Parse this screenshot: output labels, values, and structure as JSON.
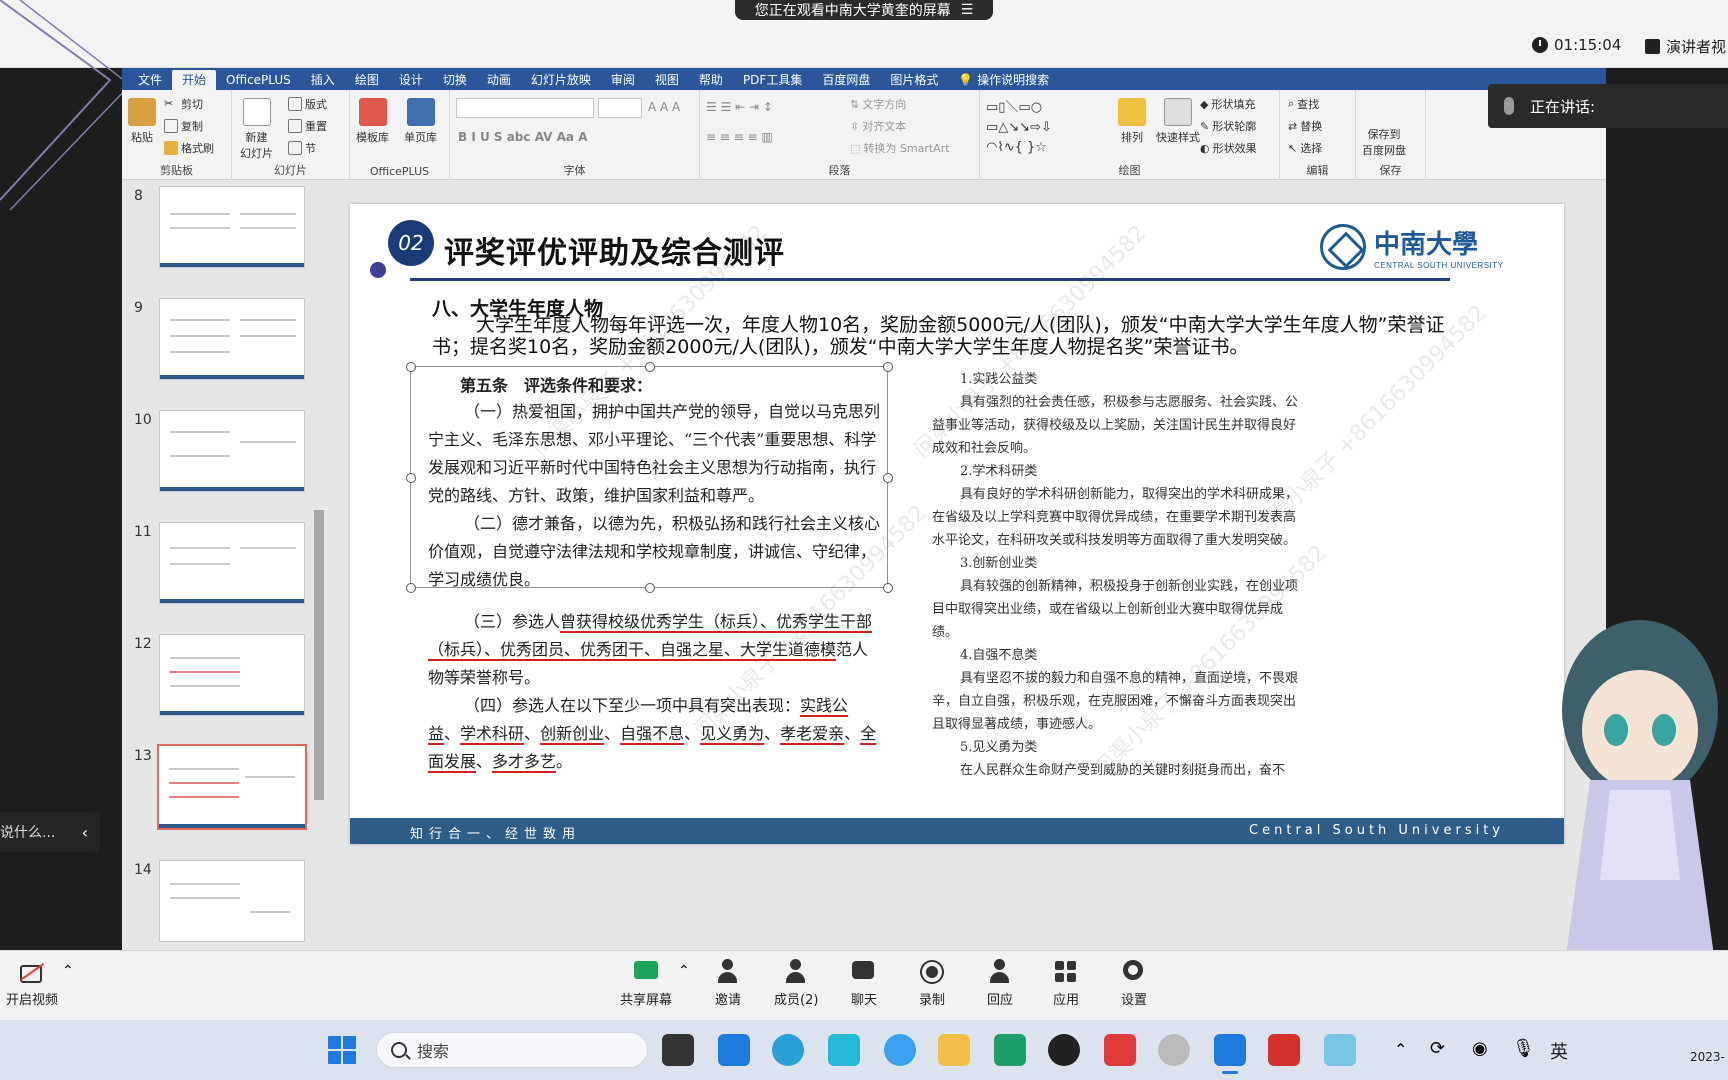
{
  "meeting": {
    "share_banner": "您正在观看中南大学黄奎的屏幕",
    "timer": "01:15:04",
    "speaker_view": "演讲者视",
    "caption_status": "正在讲话:",
    "left_hint": "说什么...",
    "toolbar": [
      {
        "label": "开启视频",
        "icon": "camera-off-icon"
      },
      {
        "label": "共享屏幕",
        "icon": "share-screen-icon"
      },
      {
        "label": "邀请",
        "icon": "invite-icon"
      },
      {
        "label": "成员(2)",
        "icon": "members-icon"
      },
      {
        "label": "聊天",
        "icon": "chat-icon"
      },
      {
        "label": "录制",
        "icon": "record-icon"
      },
      {
        "label": "回应",
        "icon": "reaction-icon"
      },
      {
        "label": "应用",
        "icon": "apps-icon"
      },
      {
        "label": "设置",
        "icon": "settings-icon"
      }
    ]
  },
  "ppt": {
    "menu_tabs": [
      "文件",
      "开始",
      "OfficePLUS",
      "插入",
      "绘图",
      "设计",
      "切换",
      "动画",
      "幻灯片放映",
      "审阅",
      "视图",
      "帮助",
      "PDF工具集",
      "百度网盘",
      "图片格式",
      "操作说明搜索"
    ],
    "active_tab": "开始",
    "ribbon": {
      "clipboard": {
        "label": "剪贴板",
        "paste": "粘贴",
        "cut": "剪切",
        "copy": "复制",
        "format_painter": "格式刷"
      },
      "slides": {
        "label": "幻灯片",
        "new_slide": "新建\n幻灯片",
        "layout": "版式",
        "reset": "重置",
        "section": "节"
      },
      "officeplus": {
        "label": "OfficePLUS",
        "template": "模板库",
        "single": "单页库"
      },
      "font": {
        "label": "字体"
      },
      "paragraph": {
        "label": "段落",
        "text_direction": "文字方向",
        "align_text": "对齐文本",
        "smartart": "转换为 SmartArt"
      },
      "drawing": {
        "label": "绘图",
        "arrange": "排列",
        "quick_styles": "快速样式",
        "fill": "形状填充",
        "outline": "形状轮廓",
        "effects": "形状效果"
      },
      "editing": {
        "label": "编辑",
        "find": "查找",
        "replace": "替换",
        "select": "选择"
      },
      "save": {
        "label": "保存",
        "save_baidu": "保存到\n百度网盘"
      }
    },
    "thumbnails": [
      {
        "num": "8"
      },
      {
        "num": "9"
      },
      {
        "num": "10"
      },
      {
        "num": "11"
      },
      {
        "num": "12"
      },
      {
        "num": "13",
        "selected": true
      },
      {
        "num": "14"
      }
    ],
    "slide": {
      "badge": "02",
      "title": "评奖评优评助及综合测评",
      "logo_cn": "中南大學",
      "logo_en": "CENTRAL SOUTH UNIVERSITY",
      "section_heading": "八、大学生年度人物",
      "section_intro": "大学生年度人物每年评选一次，年度人物10名，奖励金额5000元/人(团队)，颁发“中南大学大学生年度人物”荣誉证书；提名奖10名，奖励金额2000元/人(团队)，颁发“中南大学大学生年度人物提名奖”荣誉证书。",
      "article_heading": "第五条　评选条件和要求：",
      "article_p1": "（一）热爱祖国，拥护中国共产党的领导，自觉以马克思列宁主义、毛泽东思想、邓小平理论、“三个代表”重要思想、科学发展观和习近平新时代中国特色社会主义思想为行动指南，执行党的路线、方针、政策，维护国家利益和尊严。",
      "article_p2": "（二）德才兼备，以德为先，积极弘扬和践行社会主义核心价值观，自觉遵守法律法规和学校规章制度，讲诚信、守纪律，学习成绩优良。",
      "article_p3_pre": "（三）参选人",
      "article_p3_ul": "曾获得校级优秀学生（标兵）、优秀学生干部（标兵）、优秀团员、优秀团干、自强之星、大学生道德模",
      "article_p3_post": "范人物等荣誉称号。",
      "article_p4_pre": "（四）参选人在以下至少一项中具有突出表现：",
      "article_p4_items": [
        "实践公益",
        "学术科研",
        "创新创业",
        "自强不息",
        "见义勇为",
        "孝老爱亲",
        "全面发展",
        "多才多艺"
      ],
      "right_col": [
        {
          "cat": "1.实践公益类",
          "text": "具有强烈的社会责任感，积极参与志愿服务、社会实践、公益事业等活动，获得校级及以上奖励，关注国计民生并取得良好成效和社会反响。"
        },
        {
          "cat": "2.学术科研类",
          "text": "具有良好的学术科研创新能力，取得突出的学术科研成果，在省级及以上学科竞赛中取得优异成绩，在重要学术期刊发表高水平论文，在科研攻关或科技发明等方面取得了重大发明突破。"
        },
        {
          "cat": "3.创新创业类",
          "text": "具有较强的创新精神，积极投身于创新创业实践，在创业项目中取得突出业绩，或在省级以上创新创业大赛中取得优异成绩。"
        },
        {
          "cat": "4.自强不息类",
          "text": "具有坚忍不拔的毅力和自强不息的精神，直面逆境，不畏艰辛，自立自强，积极乐观，在克服困难，不懈奋斗方面表现突出且取得显著成绩，事迹感人。"
        },
        {
          "cat": "5.见义勇为类",
          "text": "在人民群众生命财产受到威胁的关键时刻挺身而出，奋不"
        }
      ],
      "footer_motto": "知行合一、经世致用",
      "footer_uni": "Central South University",
      "watermark": "问渠小泉子 +8616630994582"
    }
  },
  "taskbar": {
    "search_placeholder": "搜索",
    "ime": "英",
    "date_partial": "2023-"
  }
}
